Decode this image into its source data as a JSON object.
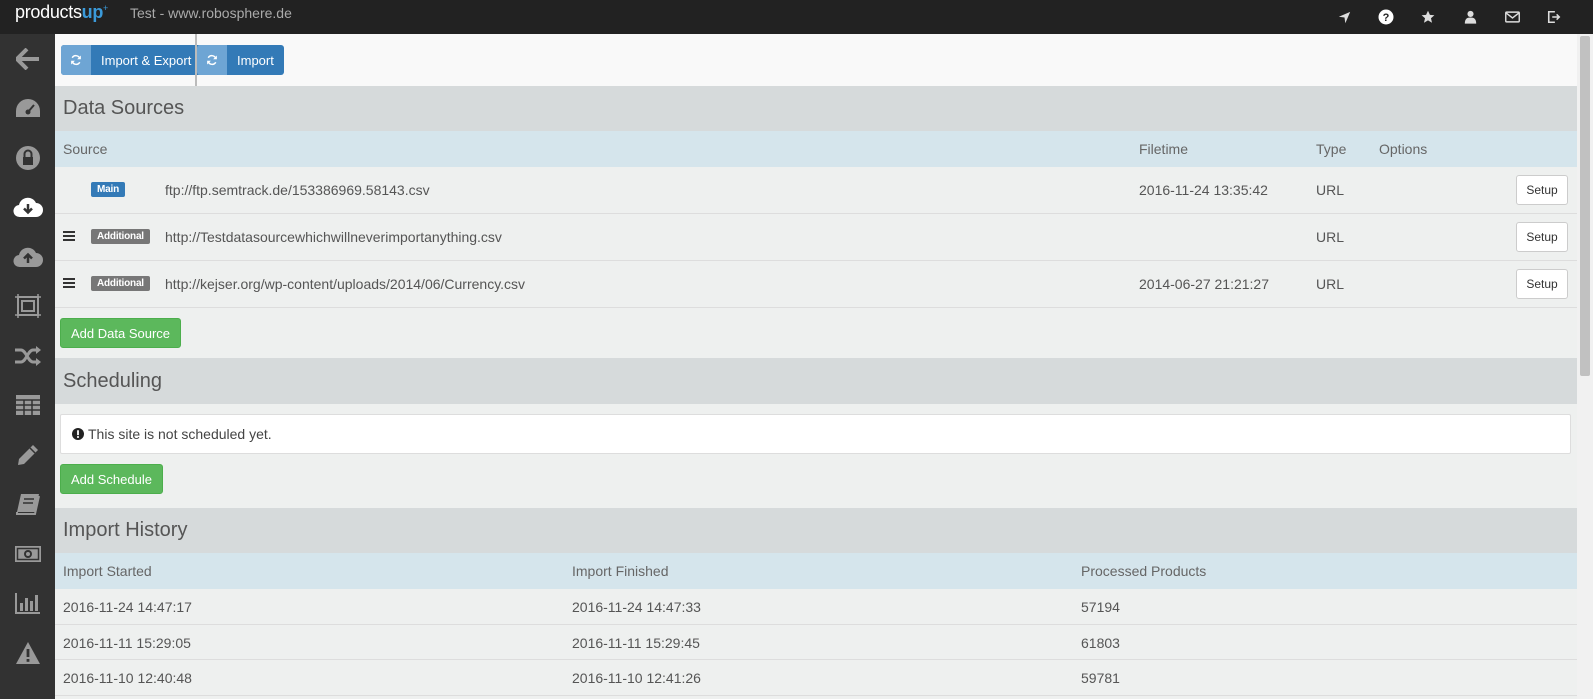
{
  "app": {
    "logo_main": "products",
    "logo_accent": "up",
    "logo_sup": "+",
    "site_title": "Test - www.robosphere.de"
  },
  "topbar_icons": [
    "location-arrow-icon",
    "help-icon",
    "star-icon",
    "user-icon",
    "mail-icon",
    "logout-icon"
  ],
  "sidebar_icons": [
    "back-arrow-icon",
    "dashboard-icon",
    "lock-icon",
    "cloud-download-icon",
    "cloud-upload-icon",
    "frame-icon",
    "shuffle-icon",
    "table-icon",
    "pencil-icon",
    "book-icon",
    "money-icon",
    "bar-chart-icon",
    "warning-icon"
  ],
  "toolbar": {
    "import_export_label": "Import & Export",
    "import_label": "Import"
  },
  "data_sources": {
    "title": "Data Sources",
    "headers": {
      "source": "Source",
      "filetime": "Filetime",
      "type": "Type",
      "options": "Options"
    },
    "rows": [
      {
        "badge": "Main",
        "source": "ftp://ftp.semtrack.de/153386969.58143.csv",
        "filetime": "2016-11-24 13:35:42",
        "type": "URL",
        "setup": "Setup"
      },
      {
        "badge": "Additional",
        "source": "http://Testdatasourcewhichwillneverimportanything.csv",
        "filetime": "",
        "type": "URL",
        "setup": "Setup"
      },
      {
        "badge": "Additional",
        "source": "http://kejser.org/wp-content/uploads/2014/06/Currency.csv",
        "filetime": "2014-06-27 21:21:27",
        "type": "URL",
        "setup": "Setup"
      }
    ],
    "add_button": "Add Data Source"
  },
  "scheduling": {
    "title": "Scheduling",
    "message": "This site is not scheduled yet.",
    "add_button": "Add Schedule"
  },
  "import_history": {
    "title": "Import History",
    "headers": {
      "started": "Import Started",
      "finished": "Import Finished",
      "processed": "Processed Products"
    },
    "rows": [
      {
        "started": "2016-11-24 14:47:17",
        "finished": "2016-11-24 14:47:33",
        "processed": "57194"
      },
      {
        "started": "2016-11-11 15:29:05",
        "finished": "2016-11-11 15:29:45",
        "processed": "61803"
      },
      {
        "started": "2016-11-10 12:40:48",
        "finished": "2016-11-10 12:41:26",
        "processed": "59781"
      }
    ]
  },
  "colors": {
    "primary": "#337ab7",
    "success": "#5cb85c",
    "topbar": "#222222",
    "sidebar": "#323232",
    "section_bg": "#d6dadb",
    "header_bg": "#d5e5ec"
  }
}
